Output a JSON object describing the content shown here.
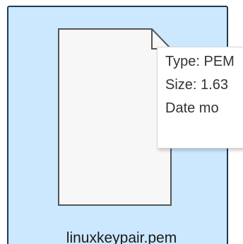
{
  "file": {
    "name": "linuxkeypair.pem",
    "icon": "document-icon"
  },
  "tooltip": {
    "type_line": "Type: PEM",
    "size_line": "Size: 1.63",
    "date_line": "Date mo"
  },
  "colors": {
    "selection_background": "#cce8ff",
    "selection_border": "#1f3a56",
    "icon_outline": "#555555",
    "icon_fill": "#f7f7f7"
  }
}
